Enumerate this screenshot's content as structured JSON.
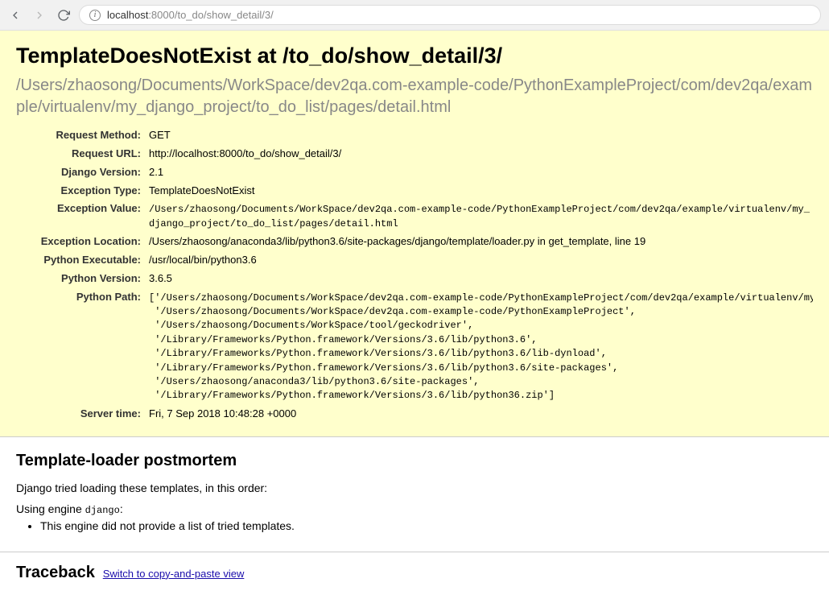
{
  "browser": {
    "url_host": "localhost",
    "url_rest": ":8000/to_do/show_detail/3/"
  },
  "error": {
    "title": "TemplateDoesNotExist at /to_do/show_detail/3/",
    "subtitle": "/Users/zhaosong/Documents/WorkSpace/dev2qa.com-example-code/PythonExampleProject/com/dev2qa/example/virtualenv/my_django_project/to_do_list/pages/detail.html",
    "meta": {
      "request_method_label": "Request Method:",
      "request_method": "GET",
      "request_url_label": "Request URL:",
      "request_url": "http://localhost:8000/to_do/show_detail/3/",
      "django_version_label": "Django Version:",
      "django_version": "2.1",
      "exception_type_label": "Exception Type:",
      "exception_type": "TemplateDoesNotExist",
      "exception_value_label": "Exception Value:",
      "exception_value": "/Users/zhaosong/Documents/WorkSpace/dev2qa.com-example-code/PythonExampleProject/com/dev2qa/example/virtualenv/my_django_project/to_do_list/pages/detail.html",
      "exception_location_label": "Exception Location:",
      "exception_location": "/Users/zhaosong/anaconda3/lib/python3.6/site-packages/django/template/loader.py in get_template, line 19",
      "python_executable_label": "Python Executable:",
      "python_executable": "/usr/local/bin/python3.6",
      "python_version_label": "Python Version:",
      "python_version": "3.6.5",
      "python_path_label": "Python Path:",
      "python_path": "['/Users/zhaosong/Documents/WorkSpace/dev2qa.com-example-code/PythonExampleProject/com/dev2qa/example/virtualenv/my_django_project',\n '/Users/zhaosong/Documents/WorkSpace/dev2qa.com-example-code/PythonExampleProject',\n '/Users/zhaosong/Documents/WorkSpace/tool/geckodriver',\n '/Library/Frameworks/Python.framework/Versions/3.6/lib/python3.6',\n '/Library/Frameworks/Python.framework/Versions/3.6/lib/python3.6/lib-dynload',\n '/Library/Frameworks/Python.framework/Versions/3.6/lib/python3.6/site-packages',\n '/Users/zhaosong/anaconda3/lib/python3.6/site-packages',\n '/Library/Frameworks/Python.framework/Versions/3.6/lib/python36.zip']",
      "server_time_label": "Server time:",
      "server_time": "Fri, 7 Sep 2018 10:48:28 +0000"
    }
  },
  "postmortem": {
    "heading": "Template-loader postmortem",
    "intro": "Django tried loading these templates, in this order:",
    "engine_prefix": "Using engine ",
    "engine_name": "django",
    "engine_suffix": ":",
    "item1": "This engine did not provide a list of tried templates."
  },
  "traceback": {
    "heading": "Traceback",
    "switch_link": "Switch to copy-and-paste view"
  }
}
